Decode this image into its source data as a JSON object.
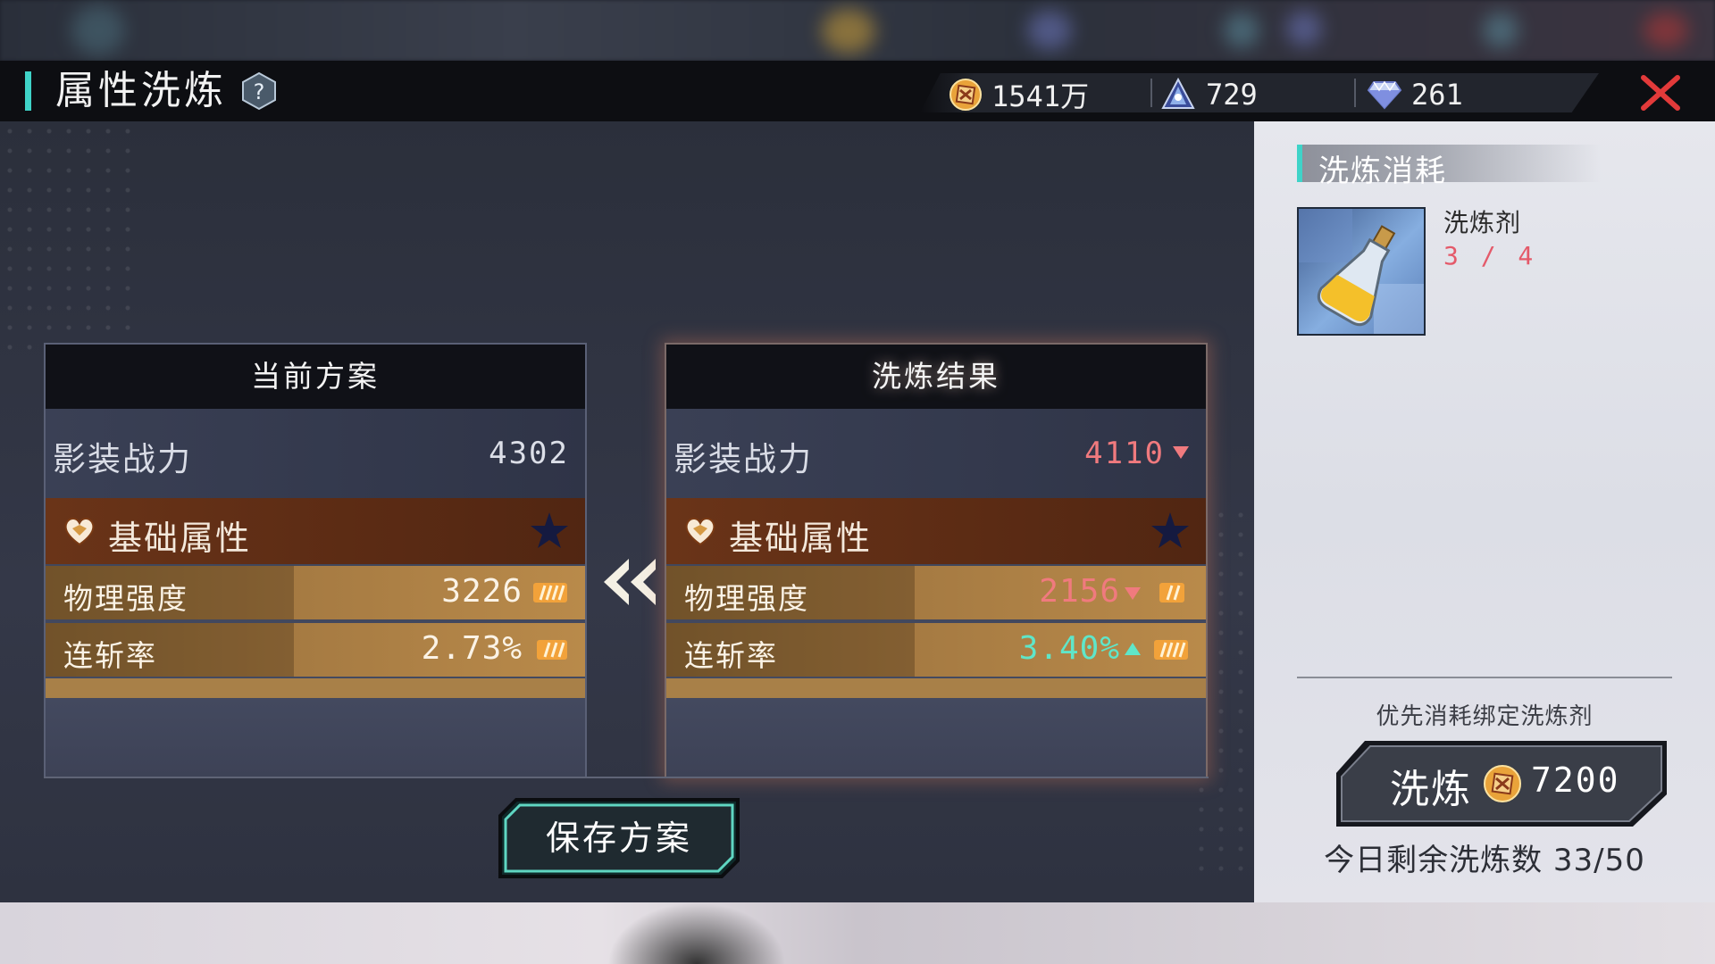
{
  "header": {
    "title": "属性洗炼",
    "currencies": [
      {
        "icon": "gold-coin-icon",
        "value": "1541万"
      },
      {
        "icon": "blue-crystal-icon",
        "value": "729"
      },
      {
        "icon": "diamond-icon",
        "value": "261"
      }
    ]
  },
  "current": {
    "title": "当前方案",
    "power_label": "影装战力",
    "power_value": "4302",
    "attr_title": "基础属性",
    "rows": [
      {
        "name": "物理强度",
        "value": "3226"
      },
      {
        "name": "连斩率",
        "value": "2.73%"
      }
    ]
  },
  "result": {
    "title": "洗炼结果",
    "power_label": "影装战力",
    "power_value": "4110",
    "attr_title": "基础属性",
    "rows": [
      {
        "name": "物理强度",
        "value": "2156",
        "trend": "down"
      },
      {
        "name": "连斩率",
        "value": "3.40%",
        "trend": "up"
      }
    ]
  },
  "save_label": "保存方案",
  "side": {
    "title": "洗炼消耗",
    "item_name": "洗炼剂",
    "item_count": "3 / 4",
    "prefer_label": "优先消耗绑定洗炼剂",
    "refine_label": "洗炼",
    "refine_cost": "7200",
    "remaining": "今日剩余洗炼数 33/50"
  },
  "colors": {
    "accent": "#3fd3c8",
    "down": "#f07a7e",
    "up": "#5fe6c9",
    "close": "#e23a3a"
  }
}
